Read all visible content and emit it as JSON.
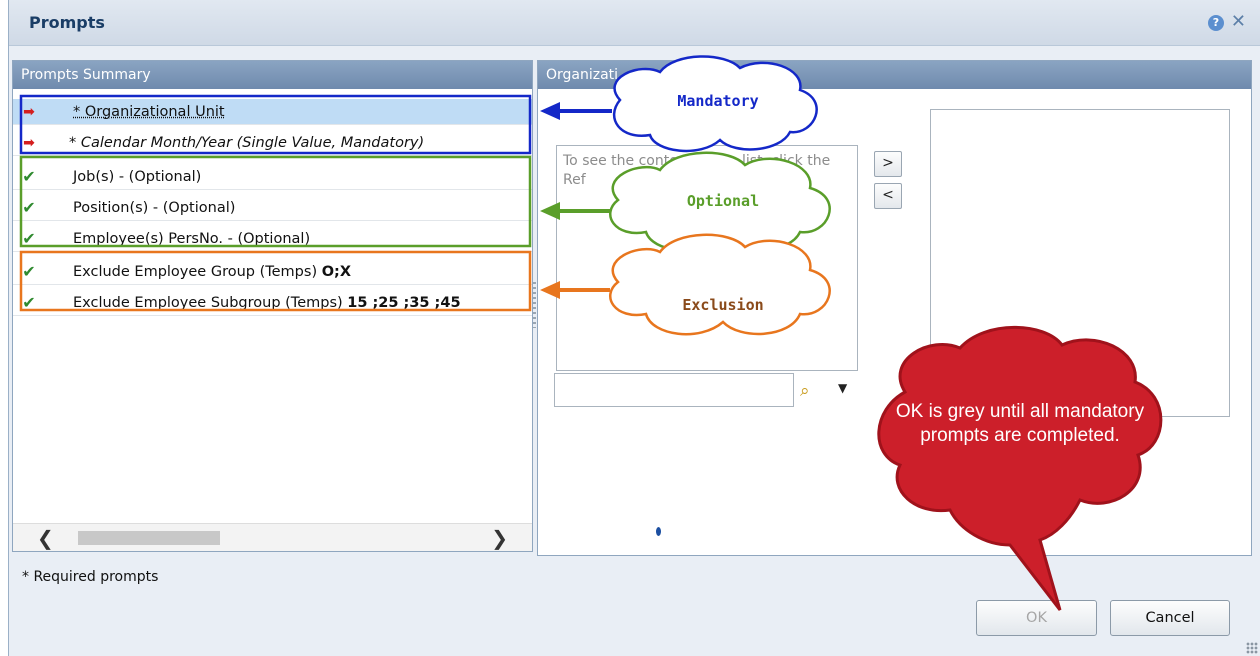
{
  "dialog": {
    "title": "Prompts",
    "help_icon": "question-mark-icon",
    "close_icon": "close-icon"
  },
  "summary": {
    "header": "Prompts Summary",
    "rows": [
      {
        "marker": "red-arrow-icon",
        "label": "* Organizational Unit",
        "value": "",
        "selected": true,
        "italic": false
      },
      {
        "marker": "red-arrow-icon",
        "label": "* Calendar Month/Year (Single Value, Mandatory)",
        "value": "",
        "selected": false,
        "italic": true
      },
      {
        "marker": "green-check-icon",
        "label": "Job(s) - (Optional)",
        "value": "",
        "selected": false,
        "italic": false
      },
      {
        "marker": "green-check-icon",
        "label": "Position(s) - (Optional)",
        "value": "",
        "selected": false,
        "italic": false
      },
      {
        "marker": "green-check-icon",
        "label": "Employee(s) PersNo. - (Optional)",
        "value": "",
        "selected": false,
        "italic": false
      },
      {
        "marker": "green-check-icon",
        "label": "Exclude Employee Group (Temps) ",
        "value": "O;X",
        "selected": false,
        "italic": false
      },
      {
        "marker": "green-check-icon",
        "label": "Exclude Employee Subgroup (Temps) ",
        "value": "15 ;25 ;35 ;45",
        "selected": false,
        "italic": false
      }
    ]
  },
  "detail": {
    "header": "Organizati",
    "list_hint": "To see the content of the list, click the Ref",
    "list_hint_tail": "of the list, click",
    "search_value": "",
    "add_button": ">",
    "remove_button": "<"
  },
  "annotations": {
    "mandatory": "Mandatory",
    "optional": "Optional",
    "exclusion": "Exclusion",
    "ok_note": "OK is grey until all mandatory prompts are completed.",
    "colors": {
      "mandatory": "#1428c8",
      "optional": "#5a9e2a",
      "exclusion": "#e8761e",
      "note": "#c8202a"
    }
  },
  "footer": {
    "required_note": "* Required prompts",
    "ok_label": "OK",
    "ok_enabled": false,
    "cancel_label": "Cancel"
  }
}
